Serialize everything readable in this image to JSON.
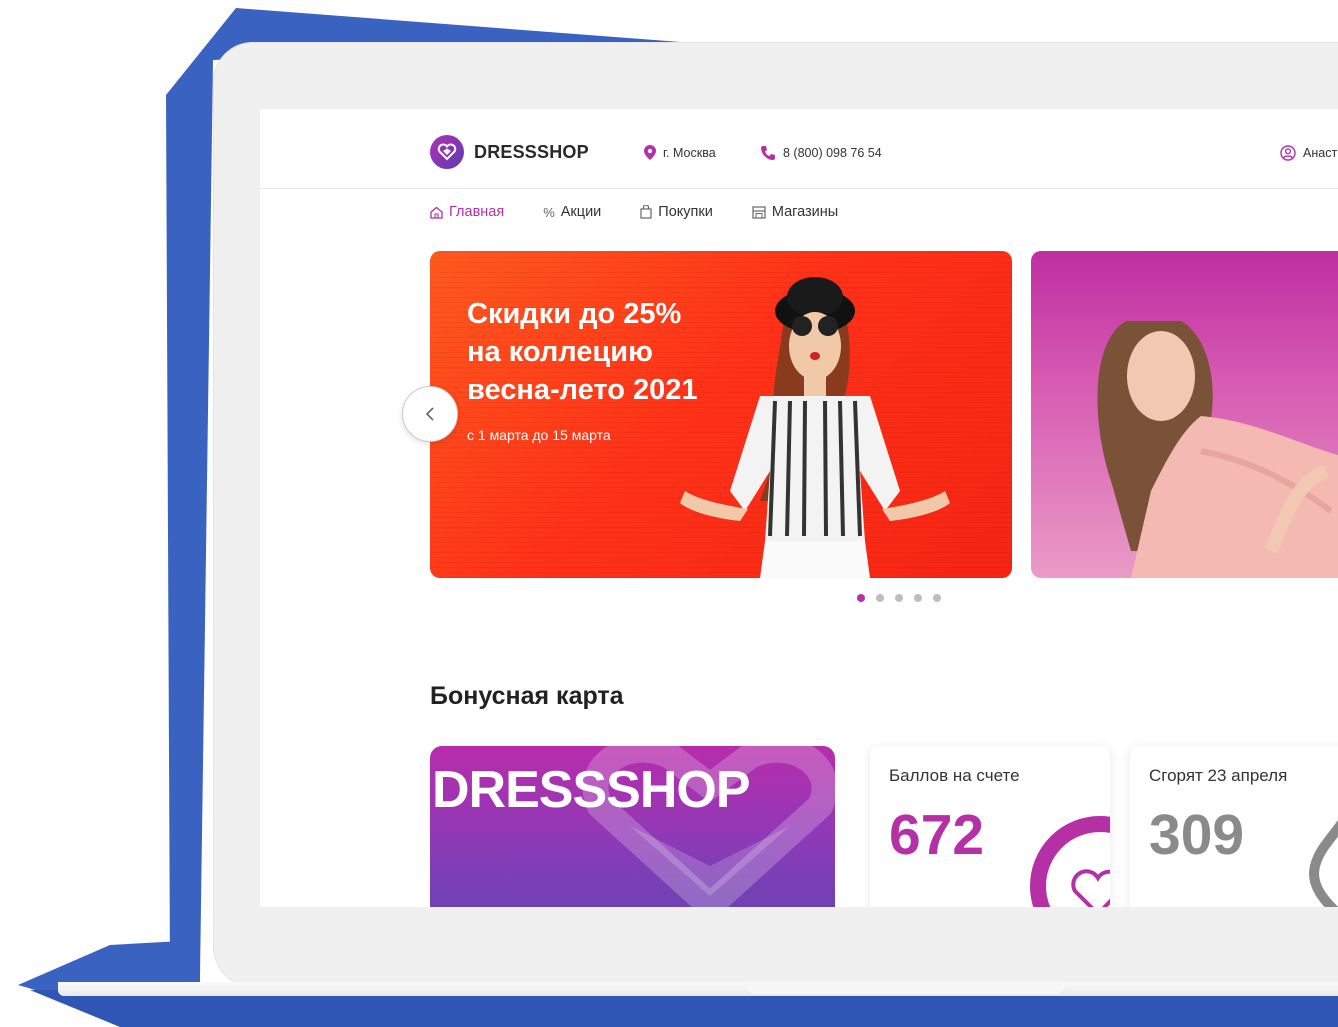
{
  "colors": {
    "brand": "#b52fa5",
    "frame_blue": "#3a62c0",
    "banner_orange": "#ff3a18",
    "muted_gray": "#8a8a8a"
  },
  "header": {
    "logo_text": "DRESSSHOP",
    "city": "г. Москва",
    "phone": "8 (800) 098 76 54",
    "profile_name": "Анаст"
  },
  "nav": {
    "items": [
      {
        "label": "Главная",
        "icon": "home-icon",
        "active": true
      },
      {
        "label": "Акции",
        "icon": "percent-icon"
      },
      {
        "label": "Покупки",
        "icon": "bag-icon"
      },
      {
        "label": "Магазины",
        "icon": "store-icon"
      }
    ]
  },
  "carousel": {
    "banner_title_lines": [
      "Скидки до 25%",
      "на коллецию",
      "весна-лето 2021"
    ],
    "banner_subtitle": "с 1 марта до 15 марта",
    "slide_count": 5,
    "active_slide": 1
  },
  "bonus": {
    "section_title": "Бонусная карта",
    "card_brand": "DRESSSHOP",
    "balance_label": "Баллов на счете",
    "balance_value": "672",
    "expiring_label": "Сгорят 23 апреля",
    "expiring_value": "309"
  }
}
